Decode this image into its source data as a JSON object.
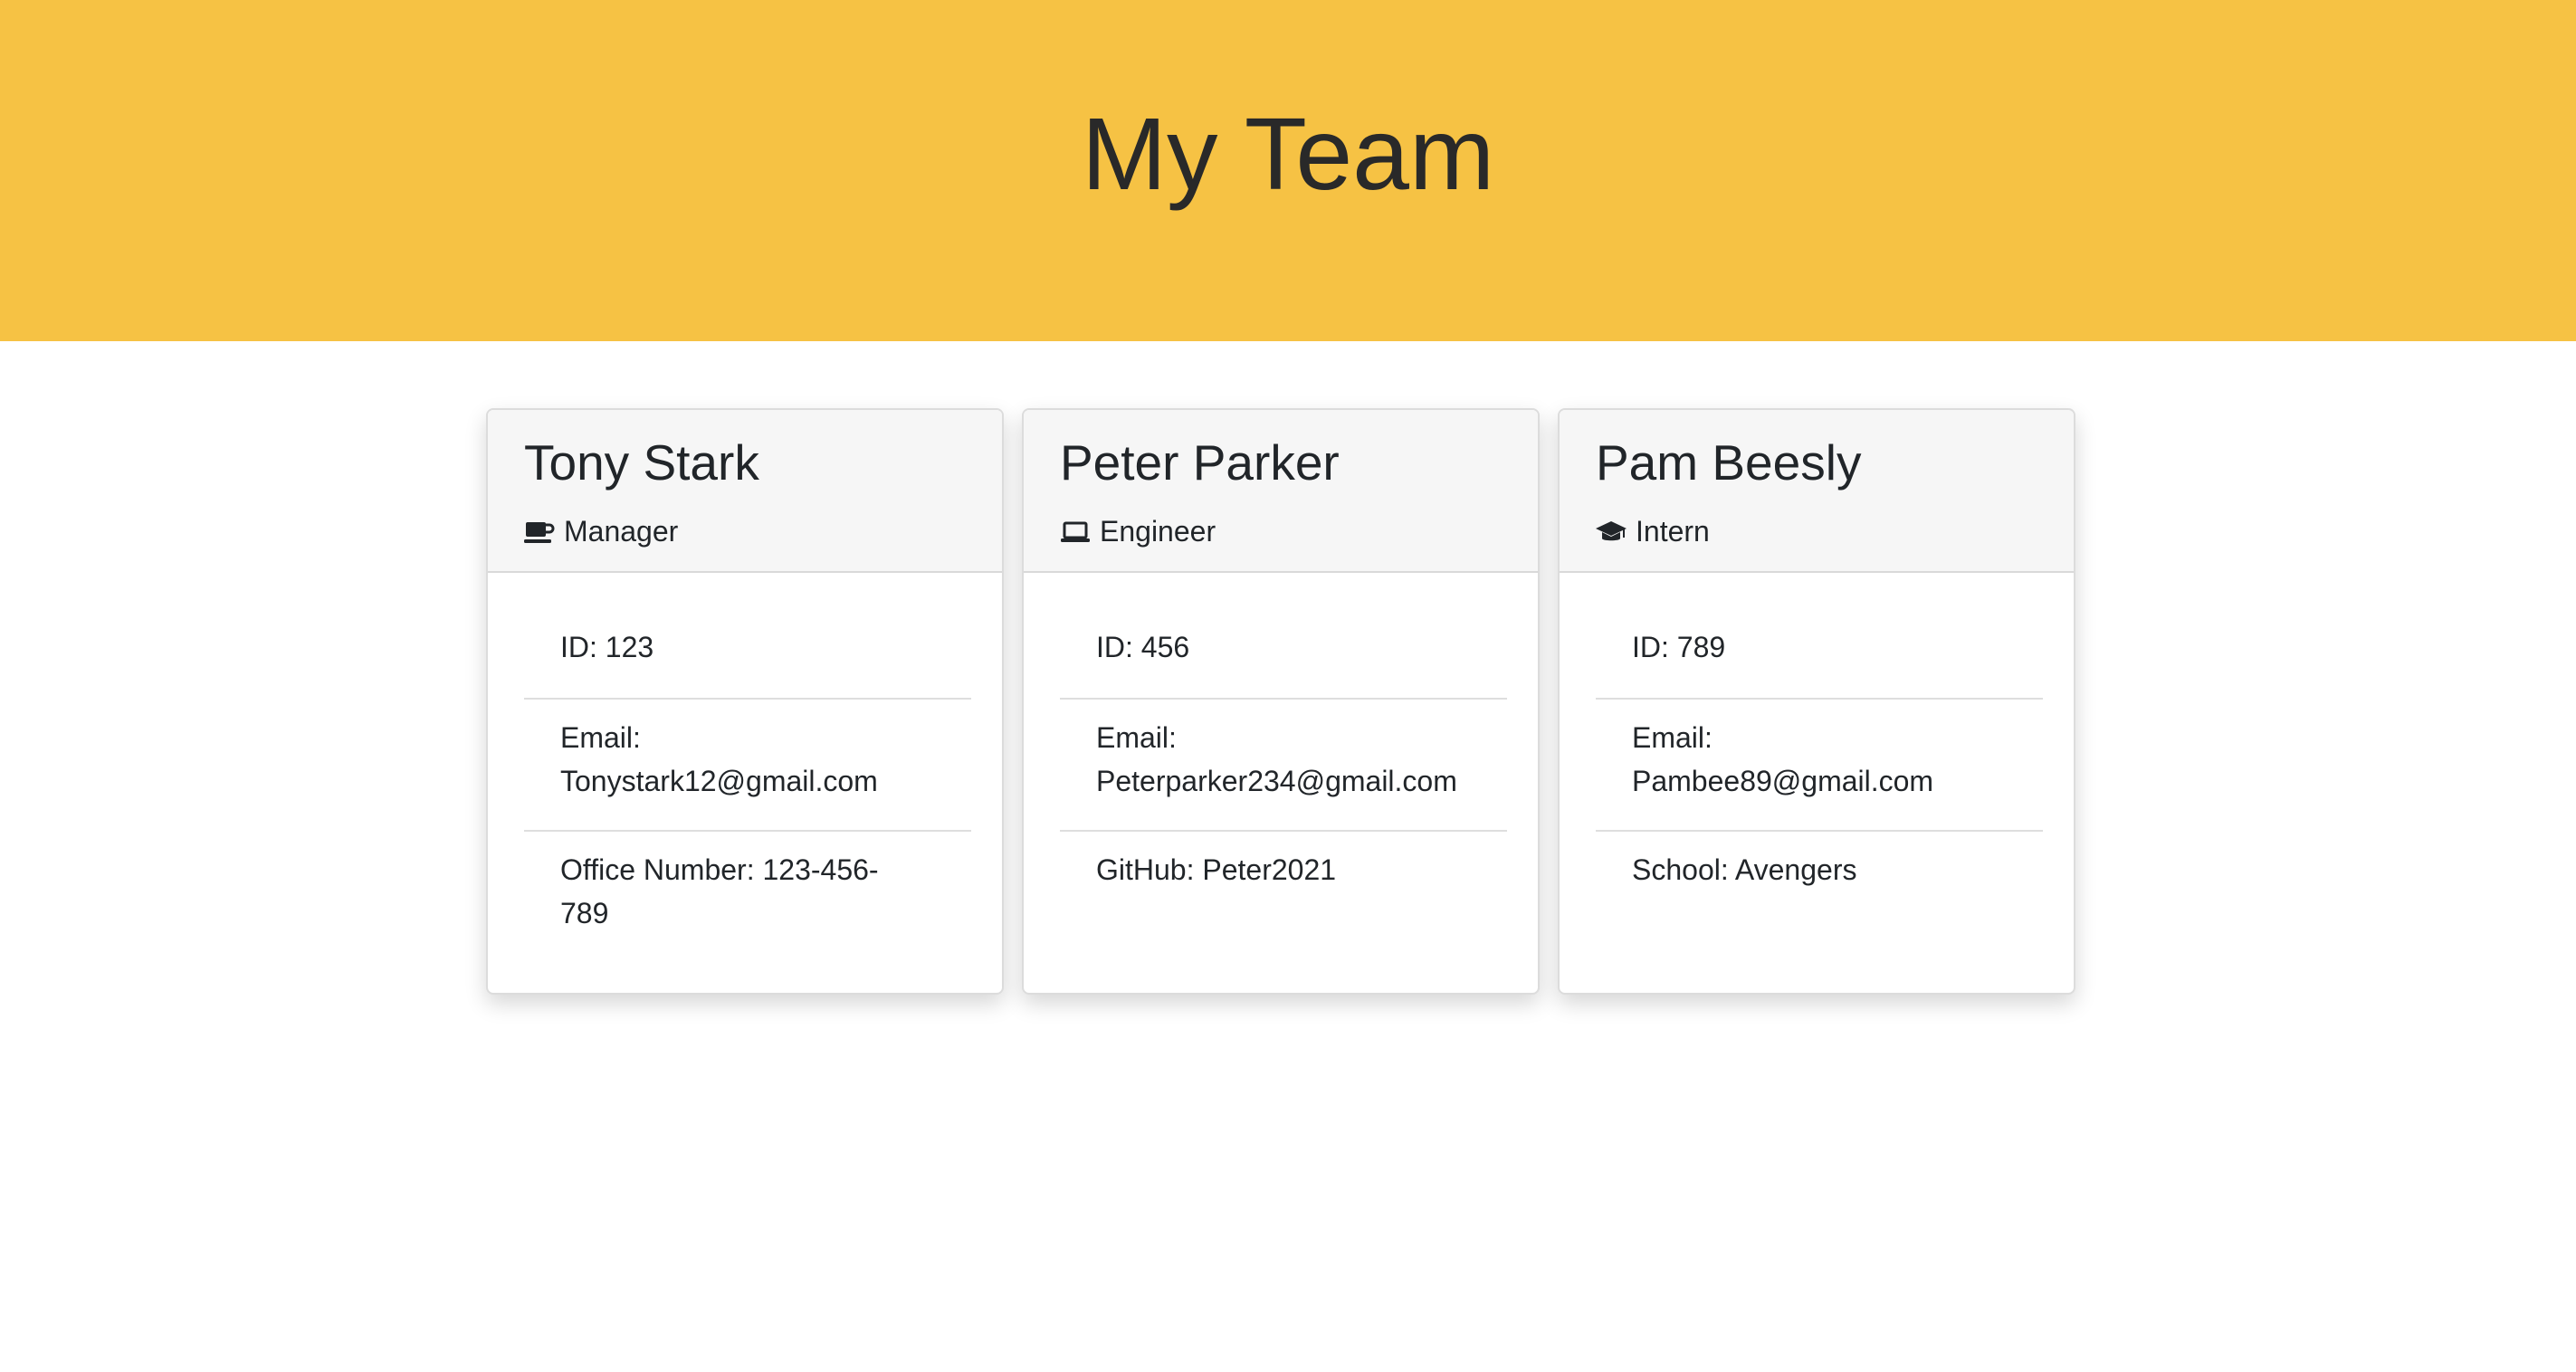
{
  "header": {
    "title": "My Team",
    "background_color": "#f6c244"
  },
  "cards": [
    {
      "name": "Tony Stark",
      "role": "Manager",
      "role_icon": "coffee-mug-icon",
      "id": "ID: 123",
      "email": "Email: Tonystark12@gmail.com",
      "email_label": "Email:",
      "email_value": "Tonystark12@gmail.com",
      "extra_line1": "Office Number: 123-456-",
      "extra_line2": "789"
    },
    {
      "name": "Peter Parker",
      "role": "Engineer",
      "role_icon": "laptop-icon",
      "id": "ID: 456",
      "email_label": "Email:",
      "email_value": "Peterparker234@gmail.com",
      "extra_line1": "GitHub: Peter2021",
      "extra_line2": ""
    },
    {
      "name": "Pam Beesly",
      "role": "Intern",
      "role_icon": "graduation-cap-icon",
      "id": "ID: 789",
      "email_label": "Email:",
      "email_value": "Pambee89@gmail.com",
      "extra_line1": "School: Avengers",
      "extra_line2": ""
    }
  ]
}
